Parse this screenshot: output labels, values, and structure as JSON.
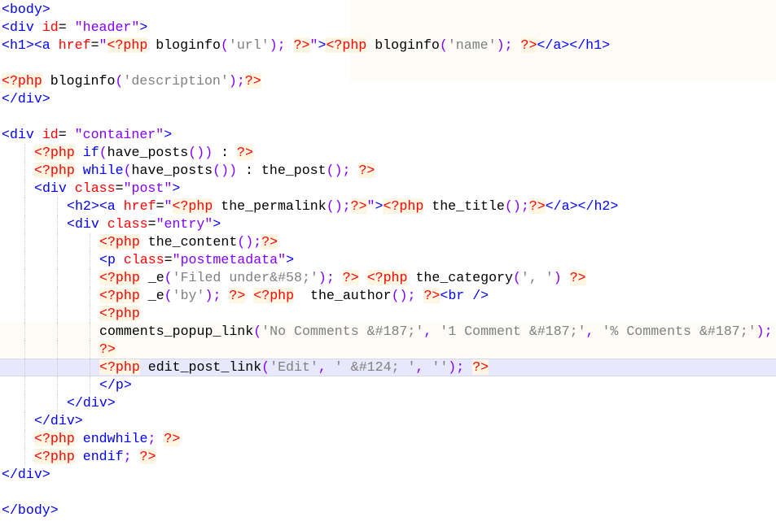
{
  "editor": {
    "current_line": 20,
    "colors": {
      "tag": "#0000ff",
      "attribute": "#ff0000",
      "attr_string": "#8000ff",
      "php_delimiter": "#ff0000",
      "php_delimiter_bg": "#fdf6e3",
      "string": "#808080",
      "punctuation": "#8000ff",
      "current_line_bg": "#e8e8fc"
    },
    "lines": [
      {
        "indent": 0,
        "tokens": [
          [
            "t",
            "<body>"
          ]
        ]
      },
      {
        "indent": 0,
        "tokens": [
          [
            "t",
            "<div"
          ],
          [
            "c",
            " "
          ],
          [
            "a",
            "id"
          ],
          [
            "c",
            "= "
          ],
          [
            "s",
            "\"header\""
          ],
          [
            "t",
            ">"
          ]
        ]
      },
      {
        "indent": 0,
        "tokens": [
          [
            "t",
            "<h1><a "
          ],
          [
            "a",
            "href"
          ],
          [
            "c",
            "="
          ],
          [
            "s",
            "\""
          ],
          [
            "p",
            "<?php"
          ],
          [
            "c",
            " bloginfo('url'); "
          ],
          [
            "p",
            "?>"
          ],
          [
            "s",
            "\""
          ],
          [
            "t",
            ">"
          ],
          [
            "p",
            "<?php"
          ],
          [
            "c",
            " bloginfo('name'); "
          ],
          [
            "p",
            "?>"
          ],
          [
            "t",
            "</a></h1>"
          ]
        ]
      },
      {
        "indent": 0,
        "tokens": []
      },
      {
        "indent": 0,
        "tokens": [
          [
            "p",
            "<?php"
          ],
          [
            "c",
            " bloginfo('description');"
          ],
          [
            "p",
            "?>"
          ]
        ]
      },
      {
        "indent": 0,
        "tokens": [
          [
            "t",
            "</div>"
          ]
        ]
      },
      {
        "indent": 0,
        "tokens": []
      },
      {
        "indent": 0,
        "tokens": [
          [
            "t",
            "<div"
          ],
          [
            "c",
            " "
          ],
          [
            "a",
            "id"
          ],
          [
            "c",
            "= "
          ],
          [
            "s",
            "\"container\""
          ],
          [
            "t",
            ">"
          ]
        ]
      },
      {
        "indent": 1,
        "tokens": [
          [
            "p",
            "<?php"
          ],
          [
            "c",
            " "
          ],
          [
            "k",
            "if"
          ],
          [
            "c",
            "(have_posts()) : "
          ],
          [
            "p",
            "?>"
          ]
        ]
      },
      {
        "indent": 1,
        "tokens": [
          [
            "p",
            "<?php"
          ],
          [
            "c",
            " "
          ],
          [
            "k",
            "while"
          ],
          [
            "c",
            "(have_posts()) : the_post(); "
          ],
          [
            "p",
            "?>"
          ]
        ]
      },
      {
        "indent": 1,
        "tokens": [
          [
            "t",
            "<div "
          ],
          [
            "a",
            "class"
          ],
          [
            "c",
            "="
          ],
          [
            "s",
            "\"post\""
          ],
          [
            "t",
            ">"
          ]
        ]
      },
      {
        "indent": 2,
        "tokens": [
          [
            "t",
            "<h2><a "
          ],
          [
            "a",
            "href"
          ],
          [
            "c",
            "="
          ],
          [
            "s",
            "\""
          ],
          [
            "p",
            "<?php"
          ],
          [
            "c",
            " the_permalink();"
          ],
          [
            "p",
            "?>"
          ],
          [
            "s",
            "\""
          ],
          [
            "t",
            ">"
          ],
          [
            "p",
            "<?php"
          ],
          [
            "c",
            " the_title();"
          ],
          [
            "p",
            "?>"
          ],
          [
            "t",
            "</a></h2>"
          ]
        ]
      },
      {
        "indent": 2,
        "tokens": [
          [
            "t",
            "<div "
          ],
          [
            "a",
            "class"
          ],
          [
            "c",
            "="
          ],
          [
            "s",
            "\"entry\""
          ],
          [
            "t",
            ">"
          ]
        ]
      },
      {
        "indent": 3,
        "tokens": [
          [
            "p",
            "<?php"
          ],
          [
            "c",
            " the_content();"
          ],
          [
            "p",
            "?>"
          ]
        ]
      },
      {
        "indent": 3,
        "tokens": [
          [
            "t",
            "<p "
          ],
          [
            "a",
            "class"
          ],
          [
            "c",
            "="
          ],
          [
            "s",
            "\"postmetadata\""
          ],
          [
            "t",
            ">"
          ]
        ]
      },
      {
        "indent": 3,
        "tokens": [
          [
            "p",
            "<?php"
          ],
          [
            "c",
            " _e('Filed under&#58;'); "
          ],
          [
            "p",
            "?>"
          ],
          [
            "c",
            " "
          ],
          [
            "p",
            "<?php"
          ],
          [
            "c",
            " the_category(', ') "
          ],
          [
            "p",
            "?>"
          ]
        ]
      },
      {
        "indent": 3,
        "tokens": [
          [
            "p",
            "<?php"
          ],
          [
            "c",
            " _e('by'); "
          ],
          [
            "p",
            "?>"
          ],
          [
            "c",
            " "
          ],
          [
            "p",
            "<?php"
          ],
          [
            "c",
            "  the_author(); "
          ],
          [
            "p",
            "?>"
          ],
          [
            "t",
            "<br />"
          ]
        ]
      },
      {
        "indent": 3,
        "tokens": [
          [
            "p",
            "<?php"
          ]
        ]
      },
      {
        "indent": 3,
        "tokens": [
          [
            "c",
            "comments_popup_link('No Comments &#187;', '1 Comment &#187;', '% Comments &#187;');"
          ]
        ]
      },
      {
        "indent": 3,
        "tokens": [
          [
            "p",
            "?>"
          ]
        ]
      },
      {
        "indent": 3,
        "tokens": [
          [
            "p",
            "<?php"
          ],
          [
            "c",
            " edit_post_link('Edit', ' &#124; ', ''); "
          ],
          [
            "p",
            "?>"
          ]
        ]
      },
      {
        "indent": 3,
        "tokens": [
          [
            "t",
            "</p>"
          ]
        ]
      },
      {
        "indent": 2,
        "tokens": [
          [
            "t",
            "</div>"
          ]
        ]
      },
      {
        "indent": 1,
        "tokens": [
          [
            "t",
            "</div>"
          ]
        ]
      },
      {
        "indent": 1,
        "tokens": [
          [
            "p",
            "<?php"
          ],
          [
            "c",
            " "
          ],
          [
            "k",
            "endwhile"
          ],
          [
            "c",
            "; "
          ],
          [
            "p",
            "?>"
          ]
        ]
      },
      {
        "indent": 1,
        "tokens": [
          [
            "p",
            "<?php"
          ],
          [
            "c",
            " "
          ],
          [
            "k",
            "endif"
          ],
          [
            "c",
            "; "
          ],
          [
            "p",
            "?>"
          ]
        ]
      },
      {
        "indent": 0,
        "tokens": [
          [
            "t",
            "</div>"
          ]
        ]
      },
      {
        "indent": 0,
        "tokens": []
      },
      {
        "indent": 0,
        "tokens": [
          [
            "t",
            "</body>"
          ]
        ]
      }
    ]
  }
}
